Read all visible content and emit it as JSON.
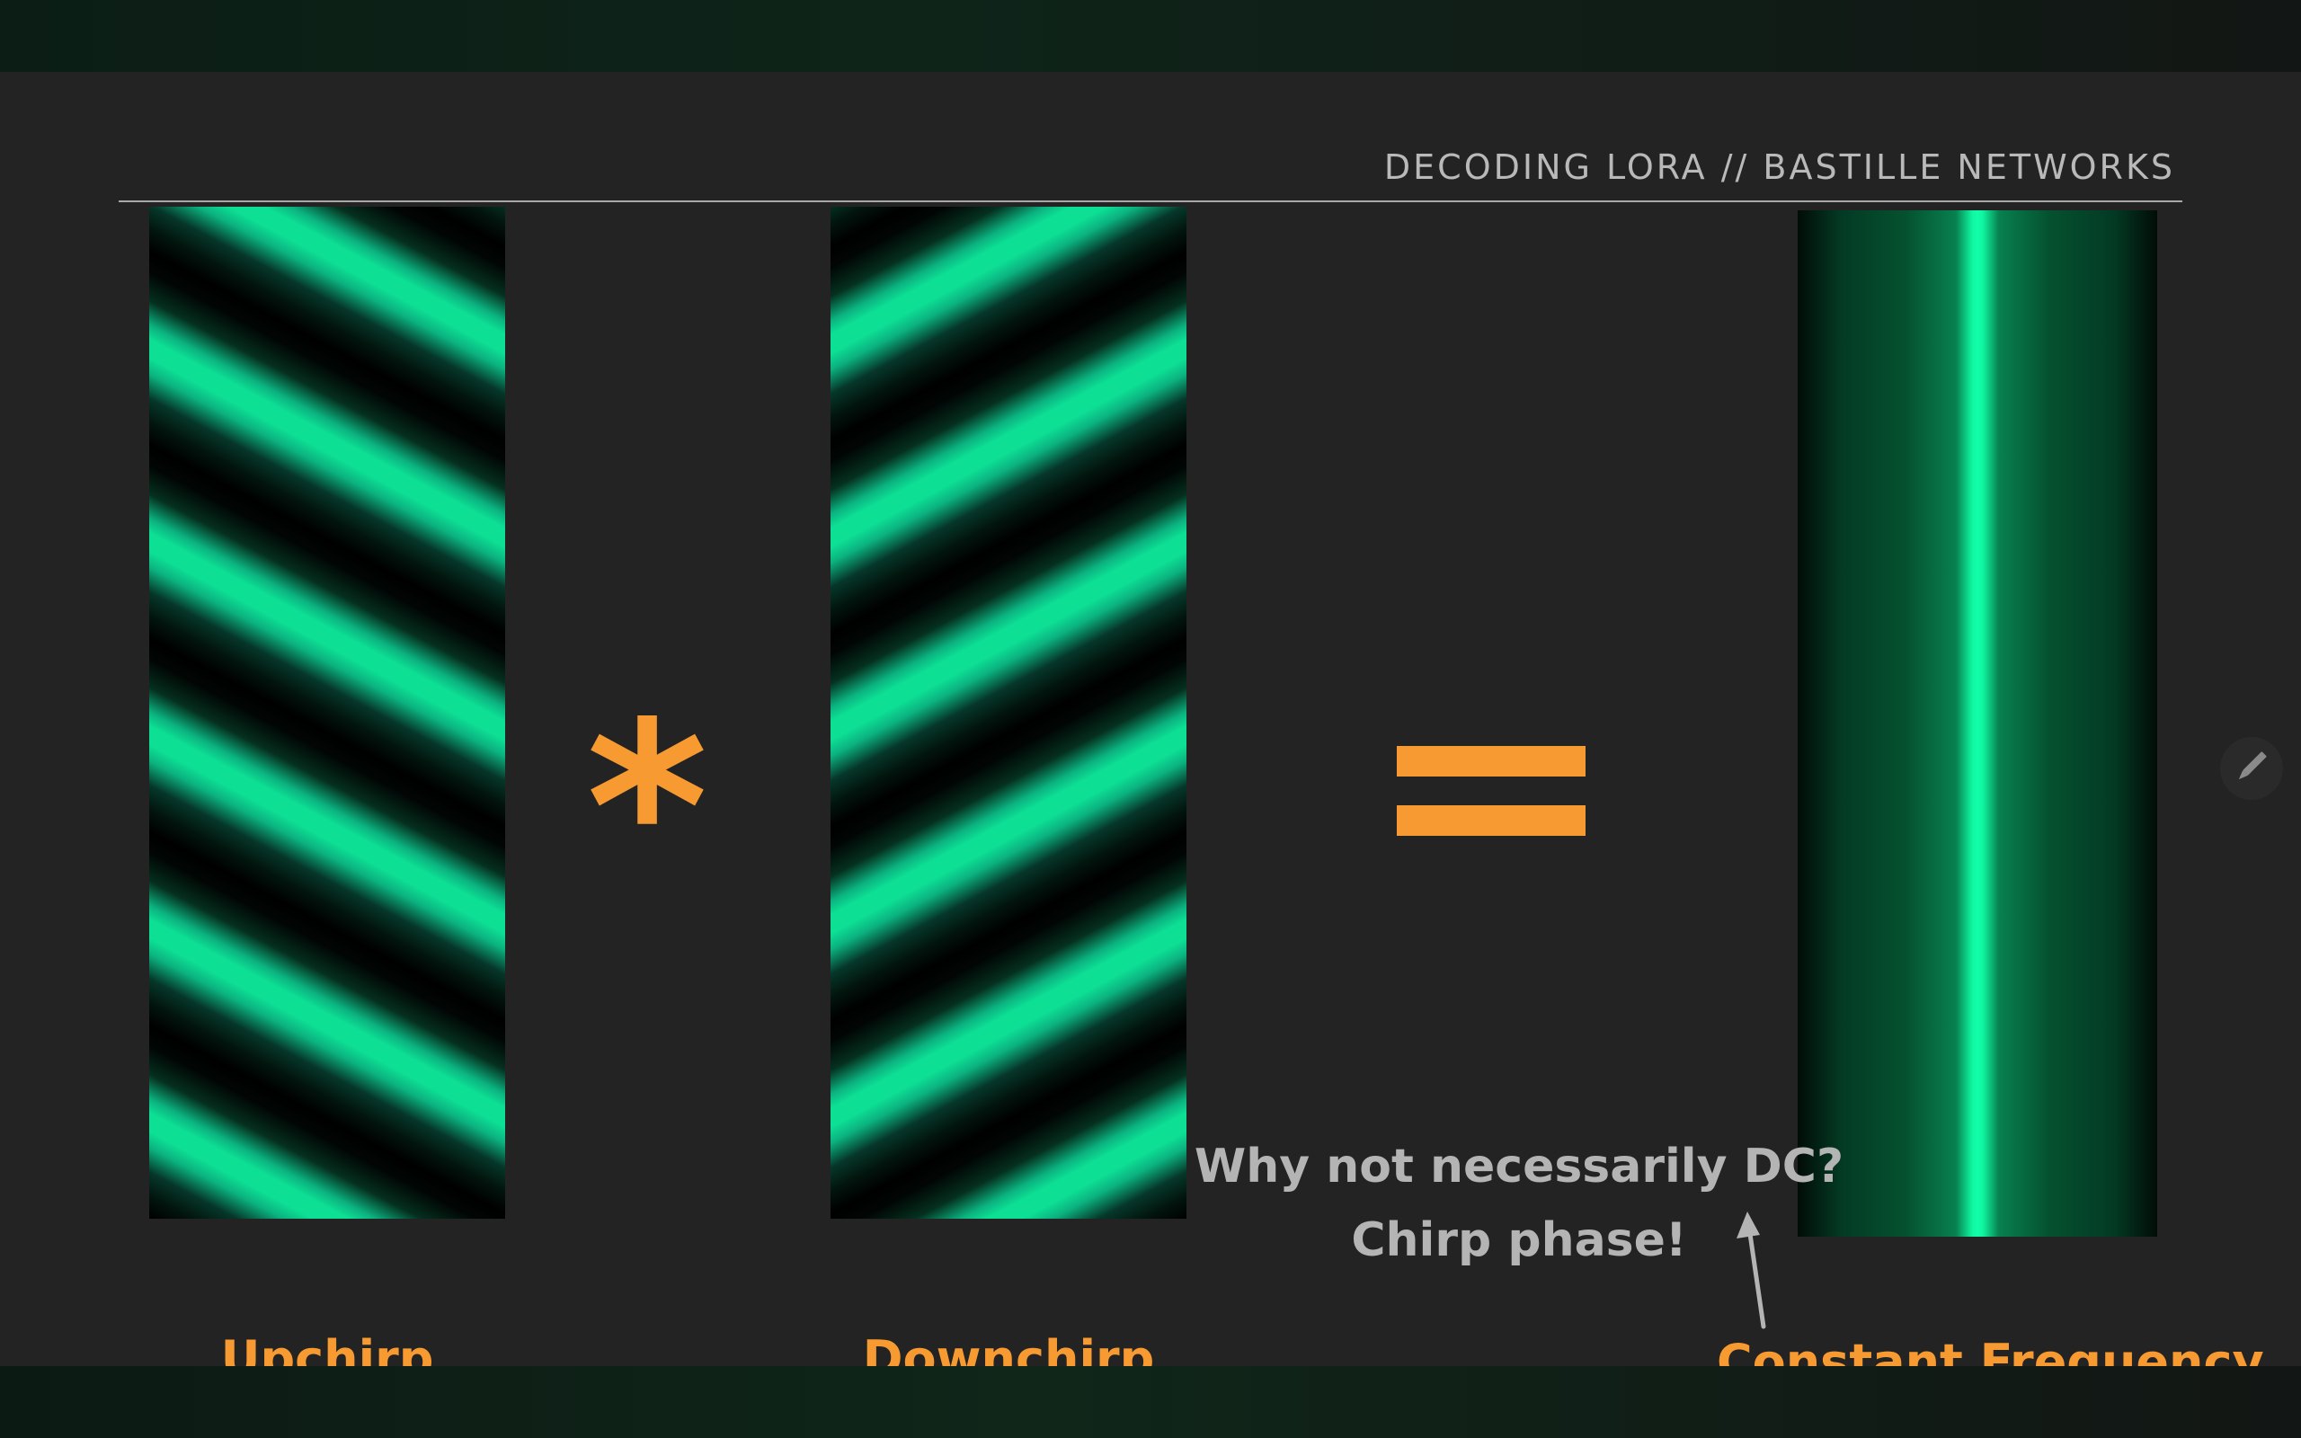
{
  "header": {
    "title": "DECODING LORA // BASTILLE NETWORKS"
  },
  "panels": {
    "upchirp_label": "Upchirp",
    "downchirp_label": "Downchirp",
    "constant_label": "Constant Frequency"
  },
  "operators": {
    "multiply": "*",
    "equals": "="
  },
  "note": {
    "line1": "Why not necessarily DC?",
    "line2": "Chirp phase!"
  },
  "icons": {
    "edit": "pencil-icon",
    "arrow": "arrow-up-icon"
  },
  "colors": {
    "accent": "#f79a32",
    "chirp_green": "#0de095",
    "note_gray": "#b4b4b4",
    "slide_bg": "#232323"
  }
}
